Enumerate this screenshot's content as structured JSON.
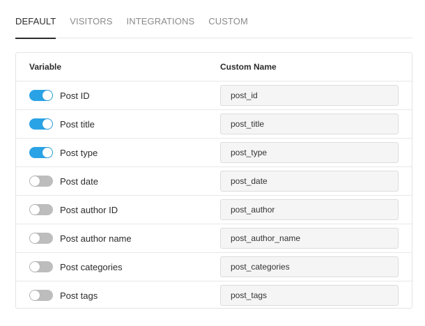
{
  "tabs": [
    {
      "label": "DEFAULT",
      "active": true
    },
    {
      "label": "VISITORS",
      "active": false
    },
    {
      "label": "INTEGRATIONS",
      "active": false
    },
    {
      "label": "CUSTOM",
      "active": false
    }
  ],
  "table": {
    "header": {
      "variable": "Variable",
      "custom_name": "Custom Name"
    },
    "rows": [
      {
        "label": "Post ID",
        "enabled": true,
        "value": "post_id"
      },
      {
        "label": "Post title",
        "enabled": true,
        "value": "post_title"
      },
      {
        "label": "Post type",
        "enabled": true,
        "value": "post_type"
      },
      {
        "label": "Post date",
        "enabled": false,
        "value": "post_date"
      },
      {
        "label": "Post author ID",
        "enabled": false,
        "value": "post_author"
      },
      {
        "label": "Post author name",
        "enabled": false,
        "value": "post_author_name"
      },
      {
        "label": "Post categories",
        "enabled": false,
        "value": "post_categories"
      },
      {
        "label": "Post tags",
        "enabled": false,
        "value": "post_tags"
      }
    ]
  },
  "colors": {
    "toggle_on": "#2aa3e6",
    "toggle_off": "#bdbdbd"
  }
}
